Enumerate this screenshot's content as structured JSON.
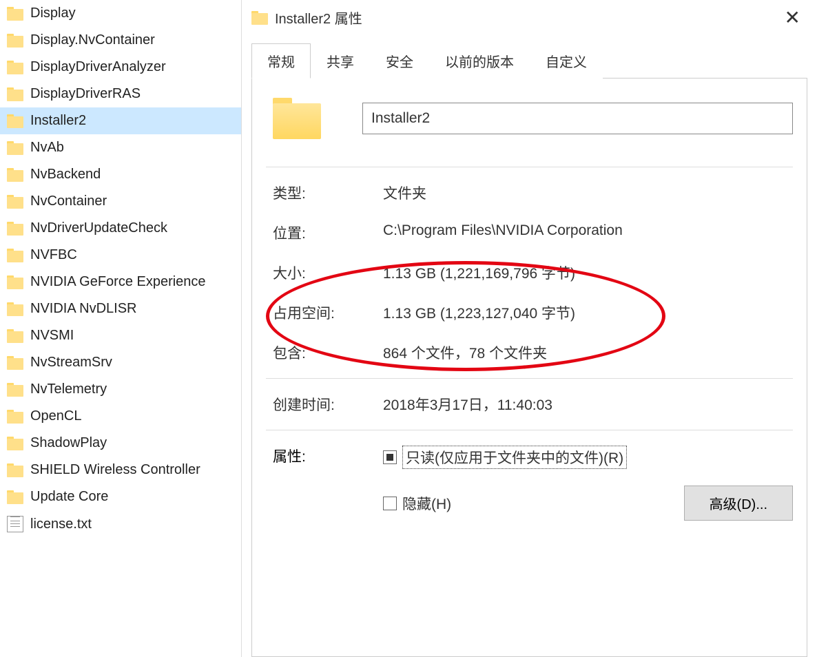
{
  "file_list": [
    {
      "name": "Display",
      "type": "folder"
    },
    {
      "name": "Display.NvContainer",
      "type": "folder"
    },
    {
      "name": "DisplayDriverAnalyzer",
      "type": "folder"
    },
    {
      "name": "DisplayDriverRAS",
      "type": "folder"
    },
    {
      "name": "Installer2",
      "type": "folder",
      "selected": true
    },
    {
      "name": "NvAb",
      "type": "folder"
    },
    {
      "name": "NvBackend",
      "type": "folder"
    },
    {
      "name": "NvContainer",
      "type": "folder"
    },
    {
      "name": "NvDriverUpdateCheck",
      "type": "folder"
    },
    {
      "name": "NVFBC",
      "type": "folder"
    },
    {
      "name": "NVIDIA GeForce Experience",
      "type": "folder"
    },
    {
      "name": "NVIDIA NvDLISR",
      "type": "folder"
    },
    {
      "name": "NVSMI",
      "type": "folder"
    },
    {
      "name": "NvStreamSrv",
      "type": "folder"
    },
    {
      "name": "NvTelemetry",
      "type": "folder"
    },
    {
      "name": "OpenCL",
      "type": "folder"
    },
    {
      "name": "ShadowPlay",
      "type": "folder"
    },
    {
      "name": "SHIELD Wireless Controller",
      "type": "folder"
    },
    {
      "name": "Update Core",
      "type": "folder"
    },
    {
      "name": "license.txt",
      "type": "file"
    }
  ],
  "dialog": {
    "title": "Installer2 属性",
    "tabs": [
      "常规",
      "共享",
      "安全",
      "以前的版本",
      "自定义"
    ],
    "active_tab": 0,
    "name_value": "Installer2",
    "rows": {
      "type_label": "类型:",
      "type_value": "文件夹",
      "location_label": "位置:",
      "location_value": "C:\\Program Files\\NVIDIA Corporation",
      "size_label": "大小:",
      "size_value": "1.13 GB (1,221,169,796 字节)",
      "disk_label": "占用空间:",
      "disk_value": "1.13 GB (1,223,127,040 字节)",
      "contains_label": "包含:",
      "contains_value": "864 个文件，78 个文件夹",
      "created_label": "创建时间:",
      "created_value": "2018年3月17日，11:40:03",
      "attr_label": "属性:",
      "readonly_label": "只读(仅应用于文件夹中的文件)(R)",
      "hidden_label": "隐藏(H)",
      "advanced_btn": "高级(D)..."
    }
  }
}
